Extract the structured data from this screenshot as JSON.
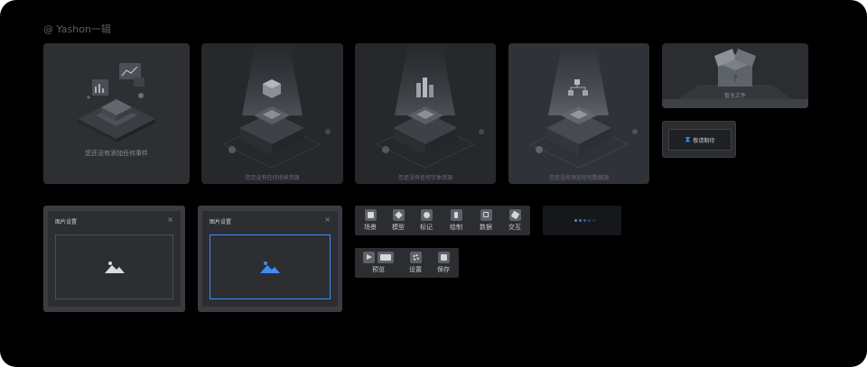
{
  "credit": "@ Yashon一辑",
  "empty_states": [
    {
      "caption": "您还没有添加任何事件"
    },
    {
      "caption": "您还没有任何场景资源"
    },
    {
      "caption": "您还没有任何字体资源"
    },
    {
      "caption": "您还没有添加任何数据源"
    },
    {
      "caption": "暂无文件"
    }
  ],
  "wait_button": {
    "label": "敬请期待"
  },
  "dialogs": [
    {
      "title": "图片设置",
      "close": "×"
    },
    {
      "title": "图片设置",
      "close": "×"
    }
  ],
  "toolbar_main": [
    {
      "label": "场景",
      "icon": "scene-icon"
    },
    {
      "label": "模型",
      "icon": "model-icon"
    },
    {
      "label": "标记",
      "icon": "mark-icon"
    },
    {
      "label": "绘制",
      "icon": "draw-icon"
    },
    {
      "label": "数据",
      "icon": "data-icon"
    },
    {
      "label": "交互",
      "icon": "interact-icon"
    }
  ],
  "toolbar_secondary": [
    {
      "label": "预览",
      "icon": "preview-icon"
    },
    {
      "label": "设置",
      "icon": "settings-icon"
    },
    {
      "label": "保存",
      "icon": "save-icon"
    }
  ],
  "colors": {
    "accent": "#3f8cf5",
    "background": "#000000",
    "panel": "#2c2e32"
  }
}
